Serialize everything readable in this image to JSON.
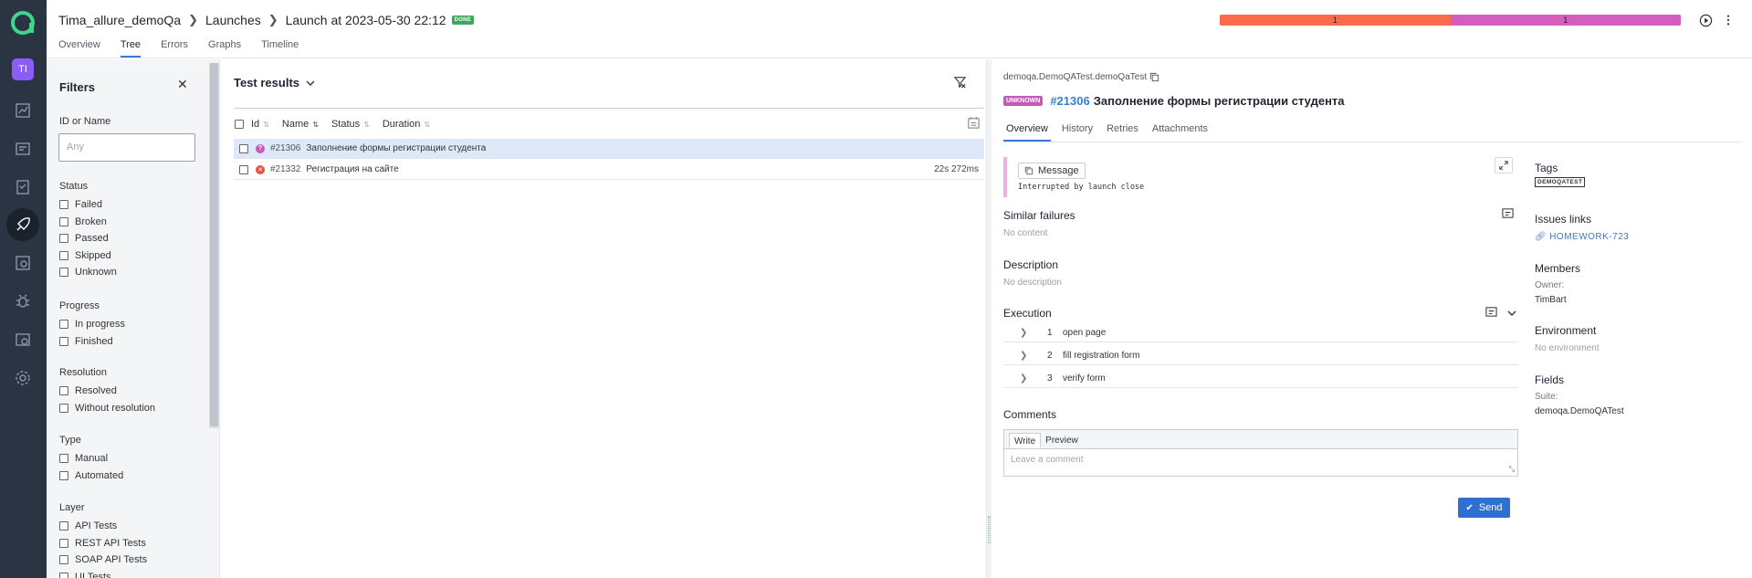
{
  "rail": {
    "avatar": "TI",
    "nav": [
      "dashboard-icon",
      "launches-icon",
      "test-cases-icon",
      "jobs-icon",
      "analytics-icon",
      "defects-icon",
      "releases-icon",
      "settings-icon"
    ]
  },
  "header": {
    "project": "Tima_allure_demoQa",
    "section": "Launches",
    "launch": "Launch at 2023-05-30 22:12",
    "done_badge": "DONE",
    "tabs": [
      "Overview",
      "Tree",
      "Errors",
      "Graphs",
      "Timeline"
    ],
    "active_tab": "Tree",
    "progress": [
      {
        "label": "1",
        "color": "#fb6a4a",
        "fraction": 0.5
      },
      {
        "label": "1",
        "color": "#d35ebe",
        "fraction": 0.5
      }
    ]
  },
  "filters": {
    "title": "Filters",
    "id_label": "ID or Name",
    "id_placeholder": "Any",
    "groups": [
      {
        "title": "Status",
        "items": [
          "Failed",
          "Broken",
          "Passed",
          "Skipped",
          "Unknown"
        ]
      },
      {
        "title": "Progress",
        "items": [
          "In progress",
          "Finished"
        ]
      },
      {
        "title": "Resolution",
        "items": [
          "Resolved",
          "Without resolution"
        ]
      },
      {
        "title": "Type",
        "items": [
          "Manual",
          "Automated"
        ]
      },
      {
        "title": "Layer",
        "items": [
          "API Tests",
          "REST API Tests",
          "SOAP API Tests",
          "UI Tests"
        ]
      }
    ]
  },
  "results": {
    "title": "Test results",
    "columns": [
      "Id",
      "Name",
      "Status",
      "Duration"
    ],
    "rows": [
      {
        "id": "#21306",
        "name": "Заполнение формы регистрации студента",
        "status": "unknown",
        "duration": "",
        "selected": true
      },
      {
        "id": "#21332",
        "name": "Регистрация на сайте",
        "status": "failed",
        "duration": "22s 272ms",
        "selected": false
      }
    ]
  },
  "details": {
    "path": "demoqa.DemoQATest.demoQaTest",
    "status_badge": "UNKNOWN",
    "id": "#21306",
    "name": "Заполнение формы регистрации студента",
    "tabs": [
      "Overview",
      "History",
      "Retries",
      "Attachments"
    ],
    "active_tab": "Overview",
    "message_button": "Message",
    "message": "Interrupted by launch close",
    "similar_title": "Similar failures",
    "similar_text": "No content",
    "description_title": "Description",
    "description_text": "No description",
    "execution_title": "Execution",
    "steps": [
      {
        "n": "1",
        "name": "open page"
      },
      {
        "n": "2",
        "name": "fill registration form"
      },
      {
        "n": "3",
        "name": "verify form"
      }
    ],
    "comments_title": "Comments",
    "comment_tabs": [
      "Write",
      "Preview"
    ],
    "comment_placeholder": "Leave a comment",
    "send_label": "Send",
    "side": {
      "tags_title": "Tags",
      "tag": "DEMOQATEST",
      "issues_title": "Issues links",
      "issue": "HOMEWORK-723",
      "members_title": "Members",
      "owner_label": "Owner:",
      "owner": "TimBart",
      "environment_title": "Environment",
      "environment_text": "No environment",
      "fields_title": "Fields",
      "suite_label": "Suite:",
      "suite": "demoqa.DemoQATest"
    }
  }
}
